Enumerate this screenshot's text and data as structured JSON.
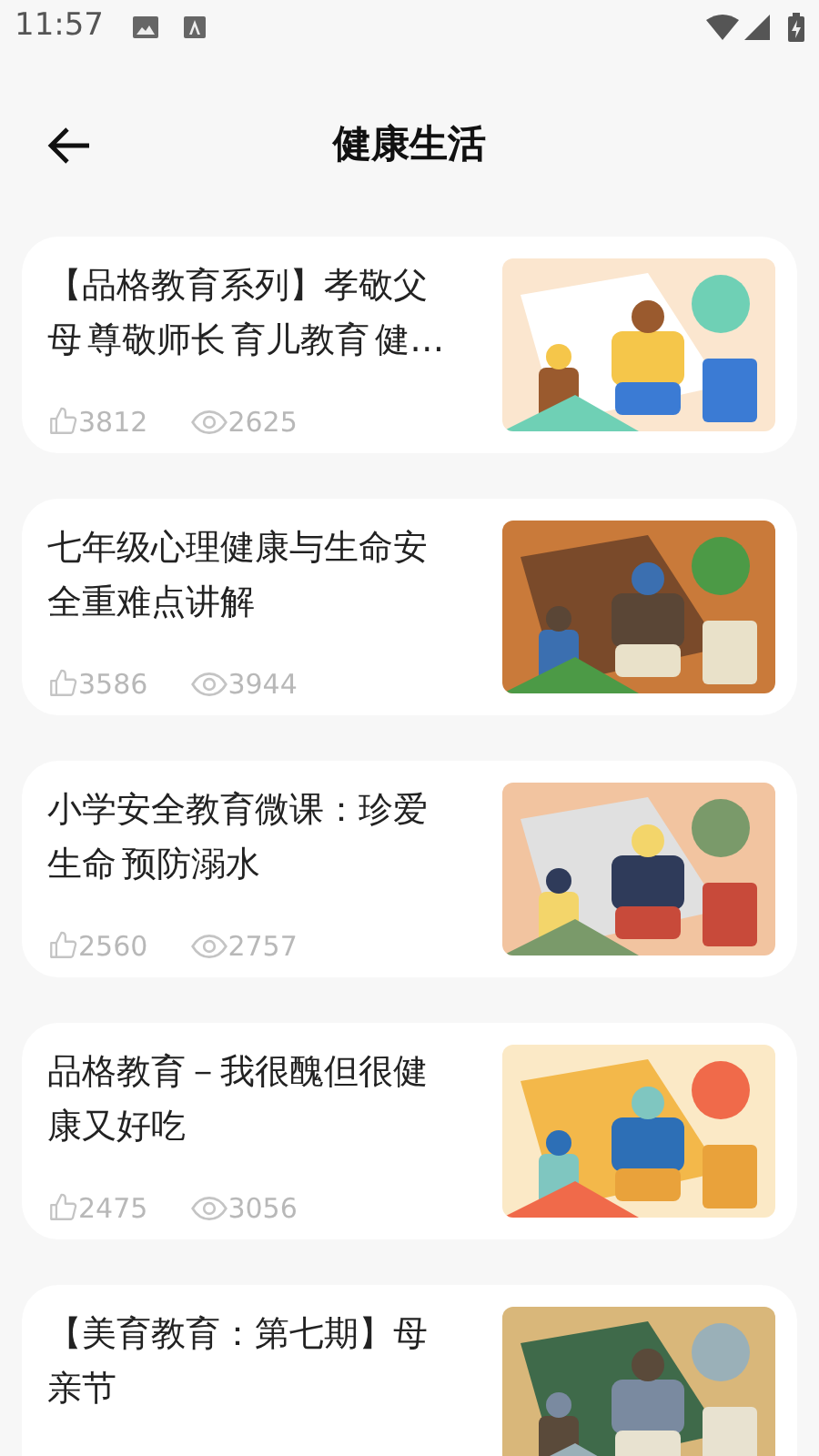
{
  "status_bar": {
    "time": "11:57"
  },
  "header": {
    "title": "健康生活"
  },
  "articles": [
    {
      "title": "【品格教育系列】孝敬父母 尊敬师长 育儿教育 健…",
      "likes": "3812",
      "views": "2625"
    },
    {
      "title": "七年级心理健康与生命安全重难点讲解",
      "likes": "3586",
      "views": "3944"
    },
    {
      "title": "小学安全教育微课：珍爱生命  预防溺水",
      "likes": "2560",
      "views": "2757"
    },
    {
      "title": "品格教育－我很醜但很健康又好吃",
      "likes": "2475",
      "views": "3056"
    },
    {
      "title": "【美育教育：第七期】母亲节"
    }
  ]
}
